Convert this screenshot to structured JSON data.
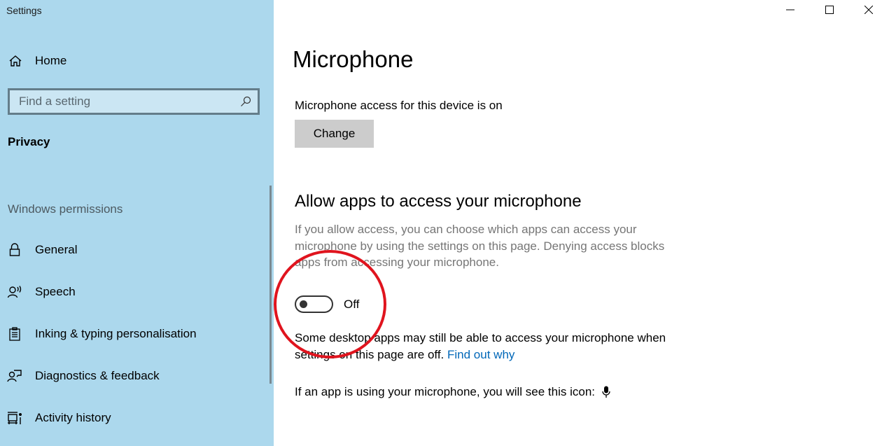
{
  "window": {
    "title": "Settings",
    "controls": {
      "minimize": "minimize-icon",
      "maximize": "maximize-icon",
      "close": "close-icon"
    }
  },
  "sidebar": {
    "home": {
      "label": "Home",
      "icon": "home-icon"
    },
    "search": {
      "placeholder": "Find a setting",
      "value": "",
      "icon": "search-icon"
    },
    "section": "Privacy",
    "group_label": "Windows permissions",
    "items": [
      {
        "label": "General",
        "icon": "lock-icon"
      },
      {
        "label": "Speech",
        "icon": "speech-icon"
      },
      {
        "label": "Inking & typing personalisation",
        "icon": "clipboard-icon"
      },
      {
        "label": "Diagnostics & feedback",
        "icon": "feedback-icon"
      },
      {
        "label": "Activity history",
        "icon": "activity-history-icon"
      }
    ]
  },
  "main": {
    "title": "Microphone",
    "device_status": "Microphone access for this device is on",
    "change_button": "Change",
    "allow_heading": "Allow apps to access your microphone",
    "allow_description": "If you allow access, you can choose which apps can access your microphone by using the settings on this page. Denying access blocks apps from accessing your microphone.",
    "toggle": {
      "state": "off",
      "label": "Off"
    },
    "note_text": "Some desktop apps may still be able to access your microphone when settings on this page are off.",
    "note_link": "Find out why",
    "icon_note": "If an app is using your microphone, you will see this icon:",
    "icon_note_icon": "microphone-icon"
  },
  "colors": {
    "sidebar_bg": "#acd8ed",
    "link": "#0067b8",
    "annotation": "#e0141e"
  }
}
